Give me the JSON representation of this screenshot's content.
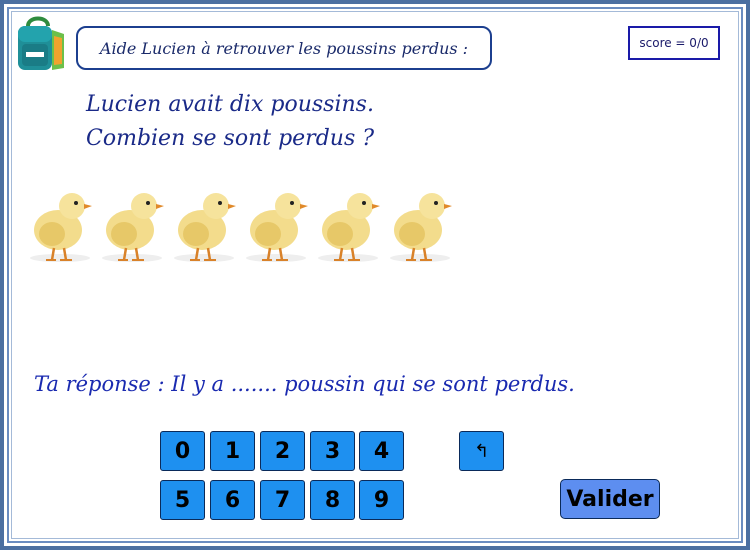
{
  "header": {
    "instruction": "Aide Lucien à retrouver les poussins perdus :",
    "score": "score = 0/0"
  },
  "question": {
    "line1": "Lucien avait dix poussins.",
    "line2": "Combien se sont perdus ?"
  },
  "chicks": {
    "visible_count": 6,
    "icon": "chick-image"
  },
  "answer": {
    "text": "Ta réponse : Il y a ....... poussin qui se sont perdus."
  },
  "keypad": {
    "digits": [
      "0",
      "1",
      "2",
      "3",
      "4",
      "5",
      "6",
      "7",
      "8",
      "9"
    ],
    "backspace_label": "↰",
    "submit_label": "Valider"
  },
  "colors": {
    "key": "#1e90f0",
    "submit": "#5d8ef0",
    "frame": "#4b6fa1",
    "text": "#1a2a88"
  }
}
